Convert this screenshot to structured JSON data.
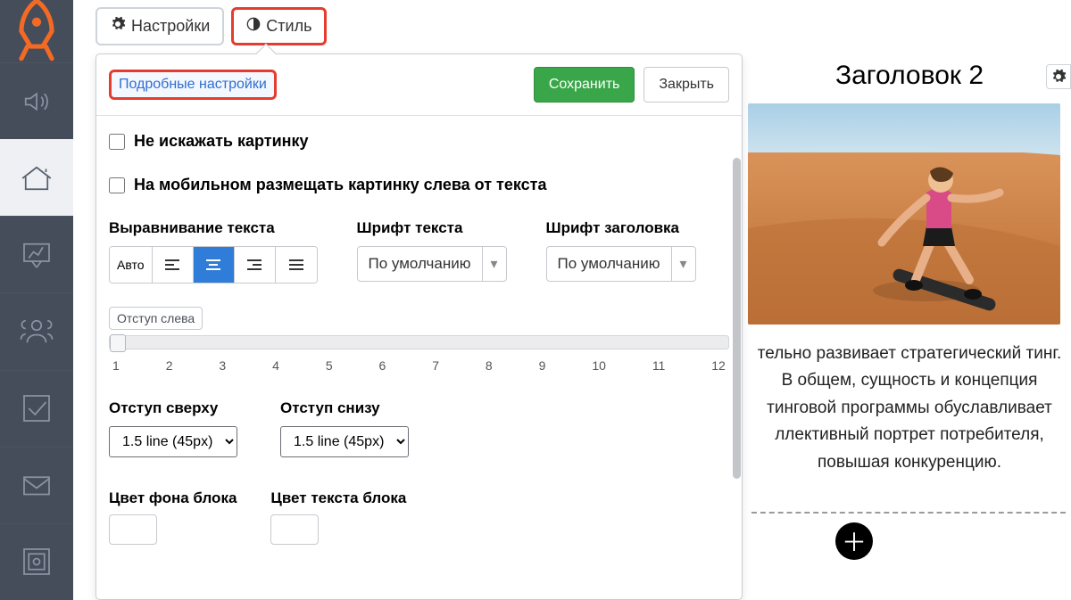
{
  "tabs": {
    "settings": "Настройки",
    "style": "Стиль"
  },
  "panel": {
    "detailed": "Подробные настройки",
    "save": "Сохранить",
    "close": "Закрыть",
    "no_distort": "Не искажать картинку",
    "mobile_left": "На мобильном размещать картинку слева от текста",
    "text_align_label": "Выравнивание текста",
    "align_auto": "Авто",
    "font_text_label": "Шрифт текста",
    "font_heading_label": "Шрифт заголовка",
    "font_default": "По умолчанию",
    "pad_left_label": "Отступ слева",
    "ticks": [
      "1",
      "2",
      "3",
      "4",
      "5",
      "6",
      "7",
      "8",
      "9",
      "10",
      "11",
      "12"
    ],
    "pad_top_label": "Отступ сверху",
    "pad_bottom_label": "Отступ снизу",
    "pad_value": "1.5 line (45px)",
    "bg_color_label": "Цвет фона блока",
    "text_color_label": "Цвет текста блока"
  },
  "preview": {
    "heading": "Заголовок 2",
    "body": "тельно развивает стратегический тинг. В общем, сущность и концепция тинговой программы обуславливает ллективный портрет потребителя, повышая конкуренцию."
  }
}
